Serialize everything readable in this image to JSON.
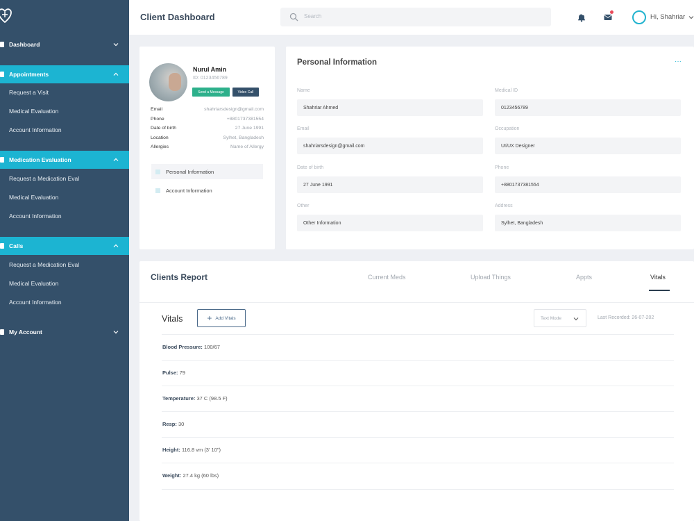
{
  "sidebar": {
    "items": [
      {
        "label": "Dashboard",
        "subitems": []
      },
      {
        "label": "Appointments",
        "subitems": [
          "Request a Visit",
          "Medical Evaluation",
          "Account Information"
        ]
      },
      {
        "label": "Medication Evaluation",
        "subitems": [
          "Request a Medication Eval",
          "Medical Evaluation",
          "Account Information"
        ]
      },
      {
        "label": "Calls",
        "subitems": [
          "Request a Medication Eval",
          "Medical Evaluation",
          "Account Information"
        ]
      },
      {
        "label": "My Account",
        "subitems": []
      }
    ]
  },
  "header": {
    "title": "Client Dashboard",
    "search_placeholder": "Search",
    "greeting": "Hi, Shahriar"
  },
  "profile": {
    "name": "Nurul Amin",
    "id": "ID: 0123456789",
    "send_message": "Send a Message",
    "video_call": "Video Call",
    "rows": [
      {
        "label": "Email",
        "value": "shahriarsdesign@gmail.com"
      },
      {
        "label": "Phone",
        "value": "+8801737381554"
      },
      {
        "label": "Date of birth",
        "value": "27 June 1991"
      },
      {
        "label": "Location",
        "value": "Sylhet, Bangladesh"
      },
      {
        "label": "Allergies",
        "value": "Name of Allergy"
      }
    ],
    "links": [
      "Personal Information",
      "Account Information"
    ]
  },
  "personal_info": {
    "title": "Personal Information",
    "more": "···",
    "fields": [
      {
        "label": "Name",
        "value": "Shahriar Ahmed"
      },
      {
        "label": "Medical ID",
        "value": "0123456789"
      },
      {
        "label": "Email",
        "value": "shahriarsdesign@gmail.com"
      },
      {
        "label": "Occupation",
        "value": "UI/UX Designer"
      },
      {
        "label": "Date of birth",
        "value": "27 June 1991"
      },
      {
        "label": "Phone",
        "value": "+8801737381554"
      },
      {
        "label": "Other",
        "value": "Other Information"
      },
      {
        "label": "Address",
        "value": "Sylhet, Bangladesh"
      }
    ]
  },
  "report": {
    "title": "Clients Report",
    "tabs": [
      "Current Meds",
      "Upload Things",
      "Appts",
      "Vitals"
    ],
    "active_tab": "Vitals",
    "vitals_title": "Vitals",
    "add_vitals": "Add Vitals",
    "text_mode": "Text Mode",
    "last_recorded": "Last Recorded: 26-07-202",
    "vitals": [
      {
        "label": "Blood Pressure:",
        "value": "100/67"
      },
      {
        "label": "Pulse:",
        "value": "79"
      },
      {
        "label": "Temperature:",
        "value": "37 C (98.5 F)"
      },
      {
        "label": "Resp:",
        "value": "30"
      },
      {
        "label": "Height:",
        "value": "116.8 vm (3' 10\")"
      },
      {
        "label": "Weight:",
        "value": "27.4 kg (60 lbs)"
      }
    ]
  },
  "colors": {
    "sidebar_bg": "#34506a",
    "accent": "#1cb4d2",
    "send_button": "#2db08b"
  }
}
